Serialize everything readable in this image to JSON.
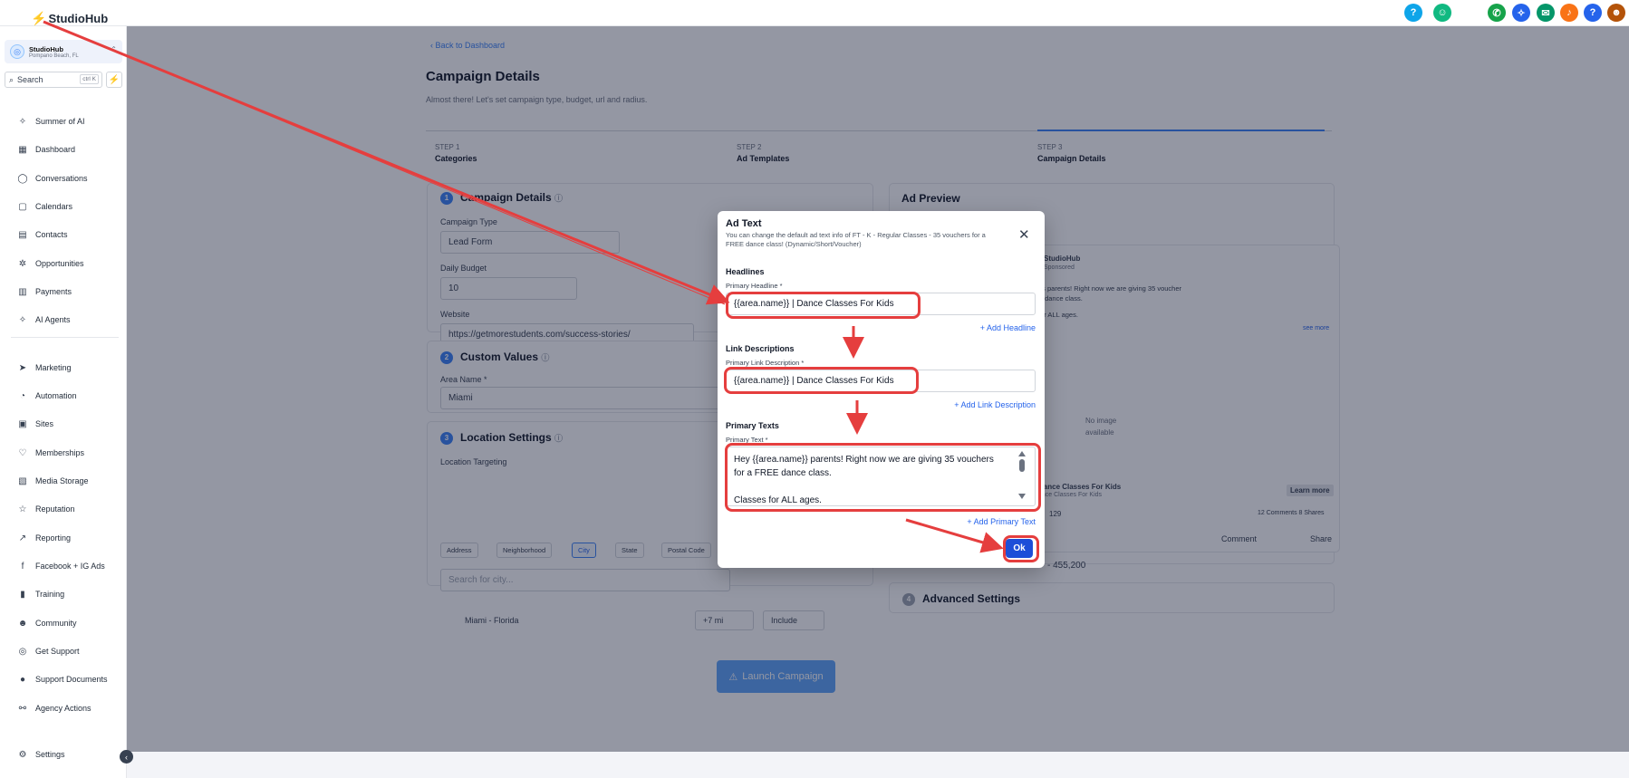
{
  "app": {
    "name": "StudioHub"
  },
  "topbar": {
    "icons": [
      "help-icon",
      "robot-icon",
      "phone-icon",
      "sparkle-icon",
      "megaphone-icon",
      "bell-icon",
      "question-icon",
      "user-avatar-icon"
    ]
  },
  "sidebar": {
    "account": {
      "name": "StudioHub",
      "location": "Pompano Beach, FL"
    },
    "search": {
      "placeholder": "Search",
      "shortcut": "ctrl K"
    },
    "items": [
      {
        "label": "Summer of AI",
        "icon": "✧"
      },
      {
        "label": "Dashboard",
        "icon": "▦"
      },
      {
        "label": "Conversations",
        "icon": "◯"
      },
      {
        "label": "Calendars",
        "icon": "▢"
      },
      {
        "label": "Contacts",
        "icon": "▤"
      },
      {
        "label": "Opportunities",
        "icon": "✲"
      },
      {
        "label": "Payments",
        "icon": "▥"
      },
      {
        "label": "AI Agents",
        "icon": "✧"
      },
      {
        "label": "Marketing",
        "icon": "➤"
      },
      {
        "label": "Automation",
        "icon": "◔"
      },
      {
        "label": "Sites",
        "icon": "▣"
      },
      {
        "label": "Memberships",
        "icon": "♡"
      },
      {
        "label": "Media Storage",
        "icon": "▧"
      },
      {
        "label": "Reputation",
        "icon": "☆"
      },
      {
        "label": "Reporting",
        "icon": "↗"
      },
      {
        "label": "Facebook + IG Ads",
        "icon": "f"
      },
      {
        "label": "Training",
        "icon": "▮"
      },
      {
        "label": "Community",
        "icon": "☻"
      },
      {
        "label": "Get Support",
        "icon": "◎"
      },
      {
        "label": "Support Documents",
        "icon": "●"
      },
      {
        "label": "Agency Actions",
        "icon": "⚯"
      }
    ],
    "settings": "Settings"
  },
  "page": {
    "back": "Back to Dashboard",
    "title": "Campaign Details",
    "subtitle": "Almost there! Let's set campaign type, budget, url and radius.",
    "steps": [
      {
        "step": "STEP 1",
        "label": "Categories"
      },
      {
        "step": "STEP 2",
        "label": "Ad Templates"
      },
      {
        "step": "STEP 3",
        "label": "Campaign Details"
      }
    ],
    "campaign": {
      "title": "Campaign Details",
      "type_label": "Campaign Type",
      "type_value": "Lead Form",
      "budget_label": "Daily Budget",
      "budget_value": "10",
      "website_label": "Website",
      "website_value": "https://getmorestudents.com/success-stories/"
    },
    "custom": {
      "title": "Custom Values",
      "area_label": "Area Name *",
      "area_value": "Miami"
    },
    "location": {
      "title": "Location Settings",
      "targeting_label": "Location Targeting",
      "chips": [
        "Address",
        "Neighborhood",
        "City",
        "State",
        "Postal Code"
      ],
      "search_placeholder": "Search for city...",
      "row_city": "Miami - Florida",
      "row_radius": "+7 mi",
      "row_include": "Include"
    },
    "launch": "Launch Campaign",
    "preview": {
      "title": "Ad Preview",
      "page_name": "StudioHub",
      "sponsored": "Sponsored",
      "text1": "es parents! Right now we are giving 35 voucher",
      "text2": "E dance class.",
      "text3": "for ALL ages.",
      "see_more": "see more",
      "no_image": "No image available",
      "headline": "Dance Classes For Kids",
      "subline": "ance Classes For Kids",
      "learn_more": "Learn more",
      "likes": "129",
      "comments_shares": "12 Comments 8 Shares",
      "comment": "Comment",
      "share": "Share",
      "reach": "- 455,200"
    },
    "advanced": {
      "title": "Advanced Settings"
    }
  },
  "modal": {
    "title": "Ad Text",
    "description": "You can change the default ad text info of FT - K - Regular Classes - 35 vouchers for a FREE dance class! (Dynamic/Short/Voucher)",
    "headlines_section": "Headlines",
    "primary_headline_label": "Primary Headline *",
    "primary_headline_value": "{{area.name}} | Dance Classes For Kids",
    "add_headline": "+ Add Headline",
    "link_section": "Link Descriptions",
    "primary_link_label": "Primary Link Description *",
    "primary_link_value": "{{area.name}} | Dance Classes For Kids",
    "add_link": "+ Add Link Description",
    "texts_section": "Primary Texts",
    "primary_text_label": "Primary Text *",
    "primary_text_line1": "Hey {{area.name}} parents! Right now we are giving 35 vouchers",
    "primary_text_line2": "for a FREE dance class.",
    "primary_text_line3": "Classes for ALL ages.",
    "add_text": "+ Add Primary Text",
    "ok": "Ok"
  },
  "colors": {
    "accent": "#3b82f6",
    "annotation": "#e53e3e",
    "ok_button": "#1d4ed8"
  }
}
